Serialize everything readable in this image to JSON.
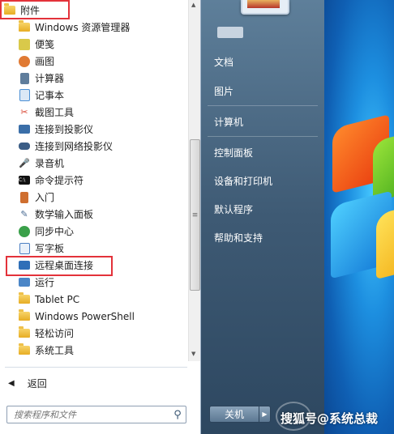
{
  "programs": {
    "folder": "附件",
    "items": [
      {
        "label": "Windows 资源管理器",
        "icon": "explorer-icon",
        "color": "#e4a829"
      },
      {
        "label": "便笺",
        "icon": "sticky-notes-icon",
        "color": "#d9c94a"
      },
      {
        "label": "画图",
        "icon": "paint-icon",
        "color": "#e07a34"
      },
      {
        "label": "计算器",
        "icon": "calculator-icon",
        "color": "#5f7d9c"
      },
      {
        "label": "记事本",
        "icon": "notepad-icon",
        "color": "#4a8fd4"
      },
      {
        "label": "截图工具",
        "icon": "snipping-tool-icon",
        "color": "#d8422e"
      },
      {
        "label": "连接到投影仪",
        "icon": "projector-icon",
        "color": "#3a6ea8"
      },
      {
        "label": "连接到网络投影仪",
        "icon": "network-projector-icon",
        "color": "#3b5d86"
      },
      {
        "label": "录音机",
        "icon": "microphone-icon",
        "color": "#555555"
      },
      {
        "label": "命令提示符",
        "icon": "cmd-icon",
        "color": "#111111"
      },
      {
        "label": "入门",
        "icon": "getting-started-icon",
        "color": "#cf6e2f"
      },
      {
        "label": "数学输入面板",
        "icon": "math-input-icon",
        "color": "#496b93"
      },
      {
        "label": "同步中心",
        "icon": "sync-center-icon",
        "color": "#3aa04a"
      },
      {
        "label": "写字板",
        "icon": "wordpad-icon",
        "color": "#4c7fc2"
      },
      {
        "label": "远程桌面连接",
        "icon": "remote-desktop-icon",
        "color": "#2f6fb8"
      },
      {
        "label": "运行",
        "icon": "run-icon",
        "color": "#4b86c7"
      },
      {
        "label": "Tablet PC",
        "icon": "folder-icon",
        "color": "#eab33a"
      },
      {
        "label": "Windows PowerShell",
        "icon": "folder-icon",
        "color": "#eab33a"
      },
      {
        "label": "轻松访问",
        "icon": "folder-icon",
        "color": "#eab33a"
      },
      {
        "label": "系统工具",
        "icon": "folder-icon",
        "color": "#eab33a"
      }
    ]
  },
  "back_label": "返回",
  "search": {
    "placeholder": "搜索程序和文件"
  },
  "right_pane": {
    "items": [
      "文档",
      "图片",
      "计算机",
      "控制面板",
      "设备和打印机",
      "默认程序",
      "帮助和支持"
    ]
  },
  "shutdown_label": "关机",
  "watermark": "搜狐号@系统总裁",
  "colors": {
    "highlight_border": "#e3323a",
    "pane_blue": "#4a6a88"
  }
}
